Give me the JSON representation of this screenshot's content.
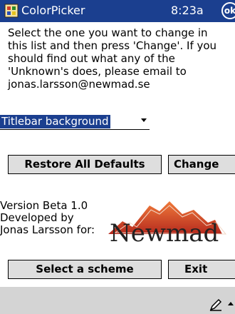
{
  "window": {
    "title": "ColorPicker",
    "clock": "8:23a",
    "ok_label": "ok"
  },
  "description": "Select the one you want to change in this list and then press 'Change'. If you should find out what any of the 'Unknown's does, please email to jonas.larsson@newmad.se",
  "selector": {
    "selected": "Titlebar background"
  },
  "buttons": {
    "restore_defaults": "Restore All Defaults",
    "change": "Change",
    "select_scheme": "Select a scheme",
    "exit": "Exit"
  },
  "version_info": {
    "line1": "Version Beta 1.0",
    "line2": "Developed by",
    "line3": "Jonas Larsson for:"
  },
  "logo": {
    "text": "Newmad"
  },
  "colors": {
    "titlebar": "#1b3f8f",
    "selection": "#1b3f8f",
    "button_face": "#dedede",
    "logo_text": "#222222",
    "logo_mountain": "#c0402a"
  },
  "icons": {
    "app": "colorpicker-app-icon",
    "input_pen": "pen-icon",
    "input_toggle": "up-arrow-icon"
  }
}
